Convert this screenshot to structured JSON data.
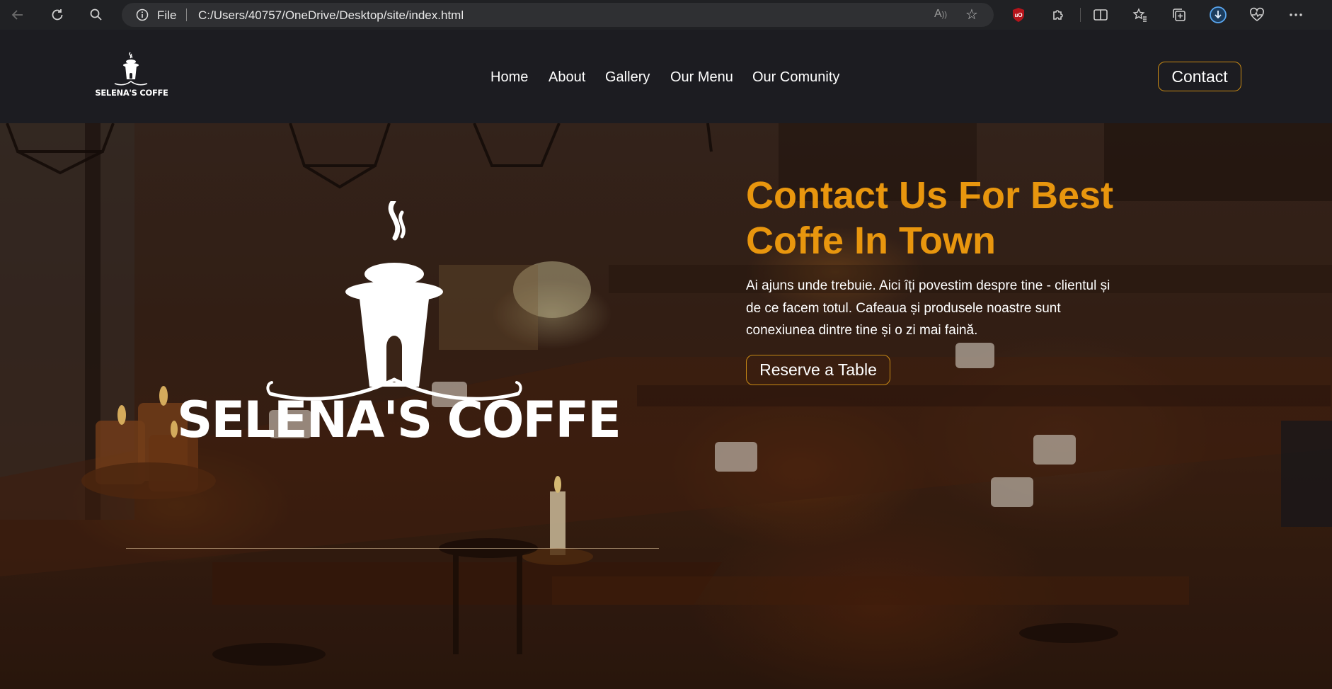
{
  "browser": {
    "address": {
      "scheme_label": "File",
      "url": "C:/Users/40757/OneDrive/Desktop/site/index.html",
      "read_aloud_label": "A̅"
    }
  },
  "site": {
    "logo_text": "SELENA'S COFFE",
    "nav": {
      "home": "Home",
      "about": "About",
      "gallery": "Gallery",
      "menu": "Our Menu",
      "community": "Our Comunity"
    },
    "contact_label": "Contact"
  },
  "hero": {
    "brand": "SELENA'S COFFE",
    "title": "Contact Us For Best Coffe In Town",
    "text": "Ai ajuns unde trebuie. Aici îți povestim despre tine - clientul și de ce facem totul. Cafeaua și produsele noastre sunt conexiunea dintre tine și o zi mai faină.",
    "button": "Reserve a Table"
  },
  "colors": {
    "accent": "#e8960e",
    "button_border": "#c98a14",
    "header_bg": "#1c1c21"
  }
}
